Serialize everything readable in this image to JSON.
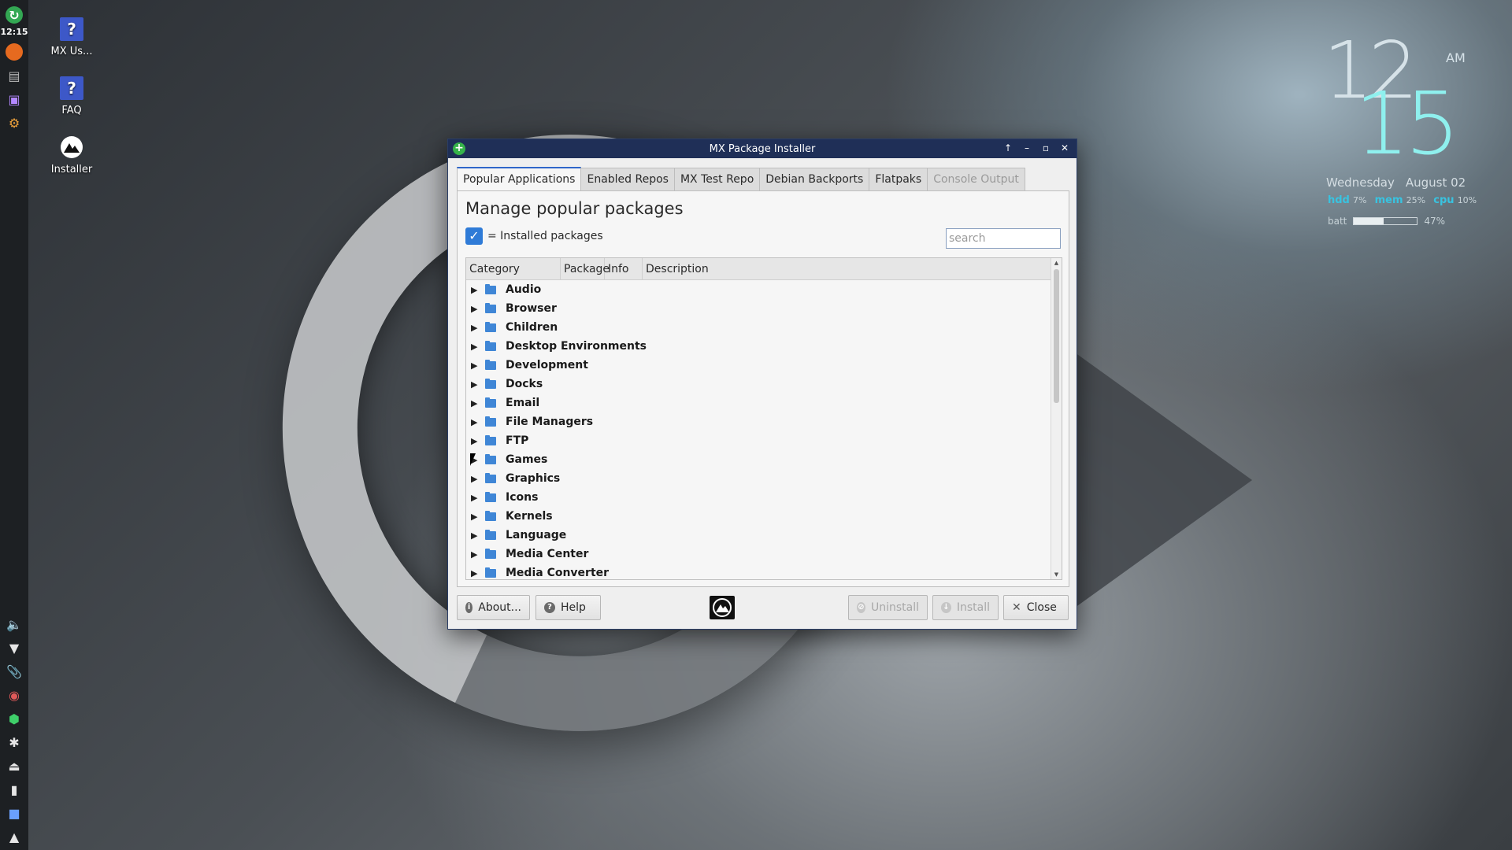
{
  "panel": {
    "clock": "12:15"
  },
  "desktop": {
    "icons": [
      {
        "label": "MX Us..."
      },
      {
        "label": "FAQ"
      },
      {
        "label": "Installer"
      }
    ]
  },
  "conky": {
    "hour": "12",
    "minute": "15",
    "ampm": "AM",
    "day": "Wednesday",
    "date": "August 02",
    "hdd_label": "hdd",
    "hdd_value": "7%",
    "mem_label": "mem",
    "mem_value": "25%",
    "cpu_label": "cpu",
    "cpu_value": "10%",
    "batt_label": "batt",
    "batt_value": "47%",
    "batt_level": 0.47
  },
  "window": {
    "title": "MX Package Installer",
    "tabs": [
      {
        "label": "Popular Applications",
        "state": "active"
      },
      {
        "label": "Enabled Repos",
        "state": "normal"
      },
      {
        "label": "MX Test Repo",
        "state": "normal"
      },
      {
        "label": "Debian Backports",
        "state": "normal"
      },
      {
        "label": "Flatpaks",
        "state": "normal"
      },
      {
        "label": "Console Output",
        "state": "disabled"
      }
    ],
    "heading": "Manage popular packages",
    "legend": "= Installed packages",
    "search_placeholder": "search",
    "columns": [
      "Category",
      "Package",
      "Info",
      "Description"
    ],
    "categories": [
      "Audio",
      "Browser",
      "Children",
      "Desktop Environments",
      "Development",
      "Docks",
      "Email",
      "File Managers",
      "FTP",
      "Games",
      "Graphics",
      "Icons",
      "Kernels",
      "Language",
      "Media Center",
      "Media Converter"
    ],
    "buttons": {
      "about": "About...",
      "help": "Help",
      "uninstall": "Uninstall",
      "install": "Install",
      "close": "Close"
    }
  },
  "colors": {
    "accent": "#2f66c9",
    "titlebar": "#1f2f57",
    "checkbox": "#2f7bd7",
    "folder": "#3f86d6"
  }
}
